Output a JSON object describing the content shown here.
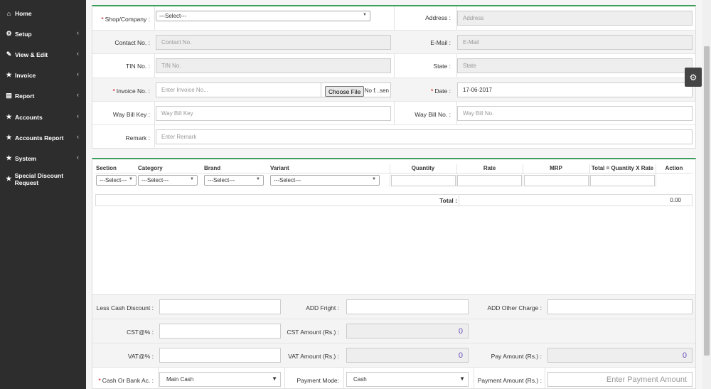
{
  "sidebar": {
    "items": [
      {
        "label": "Home",
        "icon": "home-icon",
        "glyph": "⌂",
        "chevron": false
      },
      {
        "label": "Setup",
        "icon": "gears-icon",
        "glyph": "⚙",
        "chevron": true
      },
      {
        "label": "View & Edit",
        "icon": "edit-icon",
        "glyph": "✎",
        "chevron": true
      },
      {
        "label": "Invoice",
        "icon": "star-icon",
        "glyph": "★",
        "chevron": true
      },
      {
        "label": "Report",
        "icon": "file-icon",
        "glyph": "▤",
        "chevron": true
      },
      {
        "label": "Accounts",
        "icon": "star-icon",
        "glyph": "★",
        "chevron": true
      },
      {
        "label": "Accounts Report",
        "icon": "star-icon",
        "glyph": "★",
        "chevron": true
      },
      {
        "label": "System",
        "icon": "star-icon",
        "glyph": "★",
        "chevron": true
      },
      {
        "label": "Special Discount Request",
        "icon": "star-icon",
        "glyph": "★",
        "chevron": false
      }
    ],
    "chevron_glyph": "‹"
  },
  "form": {
    "shop_label": "Shop/Company :",
    "shop_value": "---Select---",
    "address_label": "Address :",
    "address_placeholder": "Address",
    "contact_label": "Contact No. :",
    "contact_placeholder": "Contact No.",
    "email_label": "E-Mail :",
    "email_placeholder": "E-Mail",
    "tin_label": "TIN No. :",
    "tin_placeholder": "TIN No.",
    "state_label": "State :",
    "state_placeholder": "State",
    "invoice_label": "Invoice No. :",
    "invoice_placeholder": "Enter Invoice No...",
    "choose_file": "Choose File",
    "no_file": "No f...sen",
    "date_label": "Date :",
    "date_value": "17-06-2017",
    "waybill_key_label": "Way Bill Key :",
    "waybill_key_placeholder": "Way Bill Key",
    "waybill_no_label": "Way Bill No. :",
    "waybill_no_placeholder": "Way Bill No.",
    "remark_label": "Remark :",
    "remark_placeholder": "Enter Remark",
    "required_mark": "*"
  },
  "items": {
    "headers": {
      "section": "Section",
      "category": "Category",
      "brand": "Brand",
      "variant": "Variant",
      "quantity": "Quantity",
      "rate": "Rate",
      "mrp": "MRP",
      "total": "Total = Quantity X Rate",
      "action": "Action"
    },
    "section_select": "---Select---",
    "category_select": "---Select---",
    "brand_select": "---Select---",
    "variant_select": "---Select---",
    "total_label": "Total :",
    "total_value": "0.00"
  },
  "summary": {
    "less_cash_discount": "Less Cash Discount :",
    "add_fright": "ADD Fright :",
    "add_other_charge": "ADD Other Charge :",
    "cst_pct": "CST@% :",
    "cst_amount": "CST Amount (Rs.) :",
    "cst_amount_value": "0",
    "vat_pct": "VAT@% :",
    "vat_amount": "VAT Amount (Rs.) :",
    "vat_amount_value": "0",
    "pay_amount": "Pay Amount (Rs.) :",
    "pay_amount_value": "0",
    "cash_or_bank": "Cash Or Bank Ac. :",
    "cash_or_bank_value": "Main Cash",
    "payment_mode": "Payment Mode:",
    "payment_mode_value": "Cash",
    "payment_amount": "Payment Amount (Rs.) :",
    "payment_amount_placeholder": "Enter Payment Amount"
  },
  "accent_color": "#3c9d5c"
}
